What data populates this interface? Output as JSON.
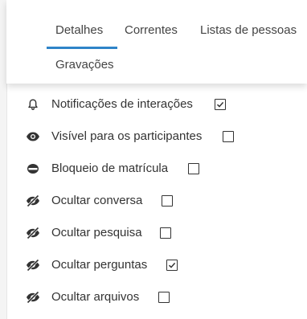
{
  "tabs": {
    "items": [
      {
        "label": "Detalhes",
        "active": true
      },
      {
        "label": "Correntes",
        "active": false
      },
      {
        "label": "Listas de pessoas",
        "active": false
      },
      {
        "label": "Gravações",
        "active": false
      }
    ]
  },
  "options": [
    {
      "label": "Notificações de interações",
      "icon": "bell-icon",
      "checked": true
    },
    {
      "label": "Visível para os participantes",
      "icon": "eye-icon",
      "checked": false
    },
    {
      "label": "Bloqueio de matrícula",
      "icon": "lock-disc-icon",
      "checked": false
    },
    {
      "label": "Ocultar conversa",
      "icon": "eye-slash-icon",
      "checked": false
    },
    {
      "label": "Ocultar pesquisa",
      "icon": "eye-slash-icon",
      "checked": false
    },
    {
      "label": "Ocultar perguntas",
      "icon": "eye-slash-icon",
      "checked": true
    },
    {
      "label": "Ocultar arquivos",
      "icon": "eye-slash-icon",
      "checked": false
    }
  ],
  "colors": {
    "accent": "#2f84c8",
    "text": "#333333"
  }
}
